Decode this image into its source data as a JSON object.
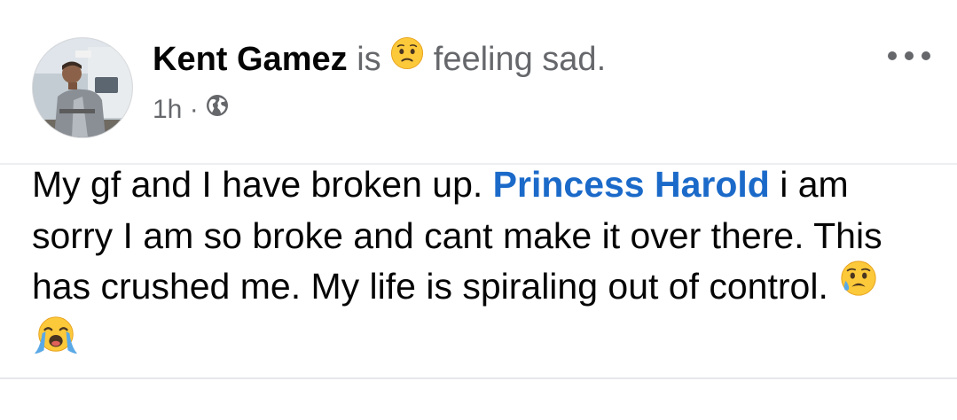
{
  "post": {
    "author": {
      "name": "Kent Gamez",
      "connector": "is",
      "feeling_text": "feeling sad.",
      "feeling_icon": "sad-face-icon"
    },
    "meta": {
      "time": "1h",
      "separator": "·",
      "audience_icon": "globe-icon"
    },
    "more_icon": "more-options-icon",
    "body": {
      "text_before_mention": "My gf and I have broken up. ",
      "mention": "Princess Harold",
      "text_after_mention": " i am sorry I am so broke and cant make it over there. This has crushed me. My life is spiraling out of control. ",
      "emojis": [
        "crying-face-icon",
        "loudly-crying-face-icon"
      ]
    }
  }
}
